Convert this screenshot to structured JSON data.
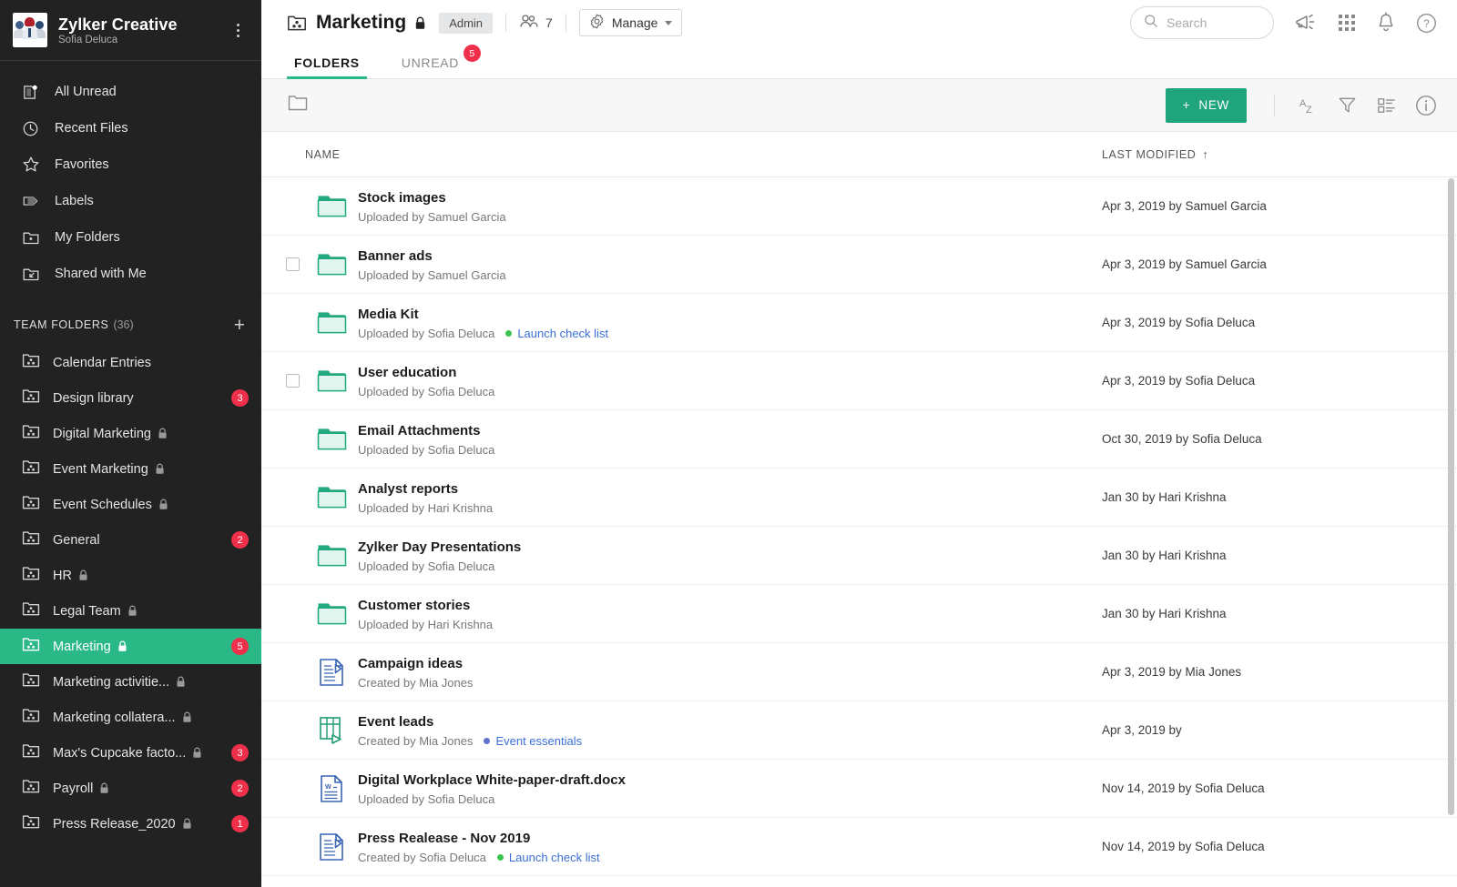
{
  "sidebar": {
    "brand": {
      "title": "Zylker Creative",
      "user": "Sofia Deluca",
      "menu_icon": "kebab-menu-icon"
    },
    "nav": [
      {
        "label": "All Unread",
        "icon": "unread-page-icon"
      },
      {
        "label": "Recent Files",
        "icon": "clock-icon"
      },
      {
        "label": "Favorites",
        "icon": "star-icon"
      },
      {
        "label": "Labels",
        "icon": "label-tag-icon"
      },
      {
        "label": "My Folders",
        "icon": "my-folder-icon"
      },
      {
        "label": "Shared with Me",
        "icon": "shared-folder-icon"
      }
    ],
    "section": {
      "title": "TEAM FOLDERS",
      "count": "(36)",
      "add_icon": "plus-icon"
    },
    "folders": [
      {
        "label": "Calendar Entries",
        "locked": false,
        "badge": ""
      },
      {
        "label": "Design library",
        "locked": false,
        "badge": "3"
      },
      {
        "label": "Digital Marketing",
        "locked": true,
        "badge": ""
      },
      {
        "label": "Event Marketing",
        "locked": true,
        "badge": ""
      },
      {
        "label": "Event Schedules",
        "locked": true,
        "badge": ""
      },
      {
        "label": "General",
        "locked": false,
        "badge": "2"
      },
      {
        "label": "HR",
        "locked": true,
        "badge": ""
      },
      {
        "label": "Legal Team",
        "locked": true,
        "badge": ""
      },
      {
        "label": "Marketing",
        "locked": true,
        "badge": "5",
        "active": true
      },
      {
        "label": "Marketing activitie...",
        "locked": true,
        "badge": ""
      },
      {
        "label": "Marketing collatera...",
        "locked": true,
        "badge": ""
      },
      {
        "label": "Max's Cupcake facto...",
        "locked": true,
        "badge": "3"
      },
      {
        "label": "Payroll",
        "locked": true,
        "badge": "2"
      },
      {
        "label": "Press Release_2020",
        "locked": true,
        "badge": "1"
      }
    ]
  },
  "header": {
    "title": "Marketing",
    "locked_icon": "lock-icon",
    "title_icon": "team-folder-icon",
    "admin_label": "Admin",
    "members_icon": "members-icon",
    "members_count": "7",
    "manage_label": "Manage",
    "manage_icon": "gear-badge-icon"
  },
  "search": {
    "placeholder": "Search",
    "value": "",
    "icon": "search-icon"
  },
  "topicons": [
    {
      "name": "announcement-megaphone-icon"
    },
    {
      "name": "apps-grid-icon"
    },
    {
      "name": "notification-bell-icon"
    },
    {
      "name": "help-question-icon"
    }
  ],
  "tabs": [
    {
      "label": "FOLDERS",
      "active": true,
      "badge": ""
    },
    {
      "label": "UNREAD",
      "active": false,
      "badge": "5"
    }
  ],
  "actionbar": {
    "breadcrumb_icon": "folder-outline-icon",
    "new_label": "NEW",
    "new_plus": "+",
    "tools": [
      {
        "name": "sort-az-icon"
      },
      {
        "name": "filter-funnel-icon"
      },
      {
        "name": "view-list-icon"
      },
      {
        "name": "info-circle-icon"
      }
    ]
  },
  "table": {
    "columns": {
      "name": "NAME",
      "last_modified": "LAST MODIFIED",
      "sort_arrow": "↑"
    },
    "rows": [
      {
        "name": "Stock images",
        "sub": "Uploaded by Samuel Garcia",
        "tag": "",
        "tag_color": "",
        "icon": "folder-icon",
        "modified": "Apr 3, 2019 by Samuel Garcia",
        "checkbox": false
      },
      {
        "name": "Banner ads",
        "sub": "Uploaded by Samuel Garcia",
        "tag": "",
        "tag_color": "",
        "icon": "folder-icon",
        "modified": "Apr 3, 2019 by Samuel Garcia",
        "checkbox": true
      },
      {
        "name": "Media Kit",
        "sub": "Uploaded by Sofia Deluca",
        "tag": "Launch check list",
        "tag_color": "#3dc44f",
        "icon": "folder-icon",
        "modified": "Apr 3, 2019 by Sofia Deluca",
        "checkbox": false
      },
      {
        "name": "User education",
        "sub": "Uploaded by Sofia Deluca",
        "tag": "",
        "tag_color": "",
        "icon": "folder-icon",
        "modified": "Apr 3, 2019 by Sofia Deluca",
        "checkbox": true
      },
      {
        "name": "Email Attachments",
        "sub": "Uploaded by Sofia Deluca",
        "tag": "",
        "tag_color": "",
        "icon": "folder-icon",
        "modified": "Oct 30, 2019 by Sofia Deluca",
        "checkbox": false
      },
      {
        "name": "Analyst reports",
        "sub": "Uploaded by Hari Krishna",
        "tag": "",
        "tag_color": "",
        "icon": "folder-icon",
        "modified": "Jan 30 by Hari Krishna",
        "checkbox": false
      },
      {
        "name": "Zylker Day Presentations",
        "sub": "Uploaded by Sofia Deluca",
        "tag": "",
        "tag_color": "",
        "icon": "folder-icon",
        "modified": "Jan 30 by Hari Krishna",
        "checkbox": false
      },
      {
        "name": "Customer stories",
        "sub": "Uploaded by Hari Krishna",
        "tag": "",
        "tag_color": "",
        "icon": "folder-icon",
        "modified": "Jan 30 by Hari Krishna",
        "checkbox": false
      },
      {
        "name": "Campaign ideas",
        "sub": "Created by Mia Jones",
        "tag": "",
        "tag_color": "",
        "icon": "writer-doc-icon",
        "modified": "Apr 3, 2019 by Mia Jones",
        "checkbox": false
      },
      {
        "name": "Event leads",
        "sub": "Created by Mia Jones",
        "tag": "Event essentials",
        "tag_color": "#6271c9",
        "icon": "sheet-icon",
        "modified": "Apr 3, 2019 by",
        "checkbox": false
      },
      {
        "name": "Digital Workplace White-paper-draft.docx",
        "sub": "Uploaded by Sofia Deluca",
        "tag": "",
        "tag_color": "",
        "icon": "word-doc-icon",
        "modified": "Nov 14, 2019 by Sofia Deluca",
        "checkbox": false
      },
      {
        "name": "Press Realease - Nov 2019",
        "sub": "Created by Sofia Deluca",
        "tag": "Launch check list",
        "tag_color": "#3dc44f",
        "icon": "writer-doc-icon",
        "modified": "Nov 14, 2019 by Sofia Deluca",
        "checkbox": false
      }
    ]
  },
  "colors": {
    "accent_green": "#2ab887",
    "new_button_green": "#20a47c",
    "badge_red": "#f0304a",
    "link_blue": "#3a6fd8",
    "sidebar_bg": "#222222"
  }
}
